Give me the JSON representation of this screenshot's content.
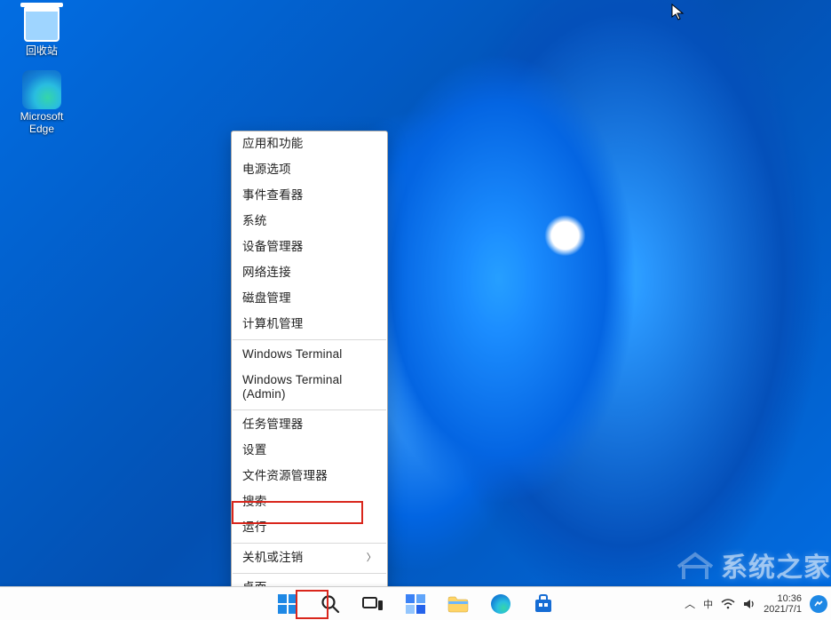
{
  "desktop": {
    "recycle_bin_label": "回收站",
    "edge_label": "Microsoft\nEdge"
  },
  "context_menu": {
    "apps_features": "应用和功能",
    "power_options": "电源选项",
    "event_viewer": "事件查看器",
    "system": "系统",
    "device_manager": "设备管理器",
    "network_connections": "网络连接",
    "disk_management": "磁盘管理",
    "computer_management": "计算机管理",
    "windows_terminal": "Windows Terminal",
    "windows_terminal_admin": "Windows Terminal (Admin)",
    "task_manager": "任务管理器",
    "settings": "设置",
    "file_explorer": "文件资源管理器",
    "search": "搜索",
    "run": "运行",
    "shutdown_signout": "关机或注销",
    "desktop": "桌面"
  },
  "tray": {
    "ime": "中",
    "time": "10:36",
    "date": "2021/7/1"
  },
  "watermark_text": "系统之家"
}
